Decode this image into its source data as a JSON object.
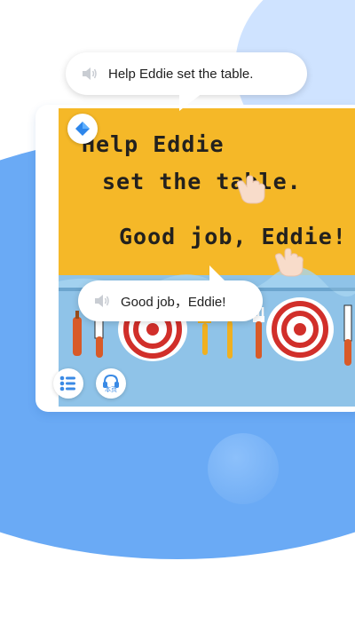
{
  "bubbles": {
    "top_text": "Help Eddie set the table.",
    "bottom_text": "Good job，Eddie!"
  },
  "story": {
    "caption_line_1": "Help Eddie",
    "caption_line_2": "set the table.",
    "caption_line_3": "Good job, Eddie!"
  },
  "controls": {
    "headphone_label": "本页"
  },
  "icons": {
    "speaker": "speaker-icon",
    "logo": "blue-diamond-icon",
    "hand": "pointing-hand-icon",
    "menu": "list-menu-icon",
    "headphone": "headphone-icon"
  },
  "colors": {
    "accent": "#3a8ae5",
    "background_blue": "#6aaaf5",
    "story_yellow": "#f5b828",
    "story_blue": "#8fc3e8"
  }
}
